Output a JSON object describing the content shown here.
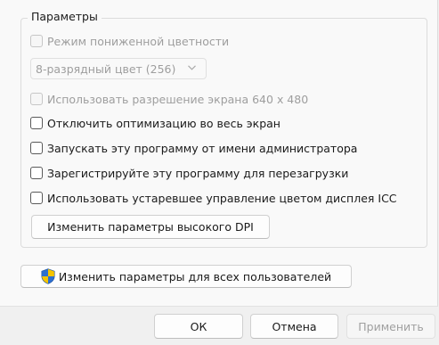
{
  "group": {
    "title": "Параметры",
    "reduced_color_mode": {
      "label": "Режим пониженной цветности",
      "checked": false,
      "enabled": false
    },
    "color_select": {
      "value": "8-разрядный цвет (256)",
      "enabled": false
    },
    "resolution_640": {
      "label": "Использовать разрешение экрана 640 x 480",
      "checked": false,
      "enabled": false
    },
    "disable_fullscreen_opt": {
      "label": "Отключить оптимизацию во весь экран",
      "checked": false
    },
    "run_as_admin": {
      "label": "Запускать эту программу от имени администратора",
      "checked": false
    },
    "register_restart": {
      "label": "Зарегистрируйте эту программу для перезагрузки",
      "checked": false
    },
    "legacy_icc": {
      "label": "Использовать устаревшее управление цветом дисплея ICC",
      "checked": false
    },
    "high_dpi_button": "Изменить параметры высокого DPI"
  },
  "all_users_button": {
    "label": "Изменить параметры для всех пользователей",
    "icon": "uac-shield-icon"
  },
  "footer": {
    "ok": "ОК",
    "cancel": "Отмена",
    "apply": "Применить"
  },
  "colors": {
    "content_bg": "#f9f9f9",
    "footer_bg": "#f0f0f0",
    "disabled_text": "#9e9e9e",
    "shield_blue": "#2c6fd1",
    "shield_yellow": "#f5c400"
  }
}
